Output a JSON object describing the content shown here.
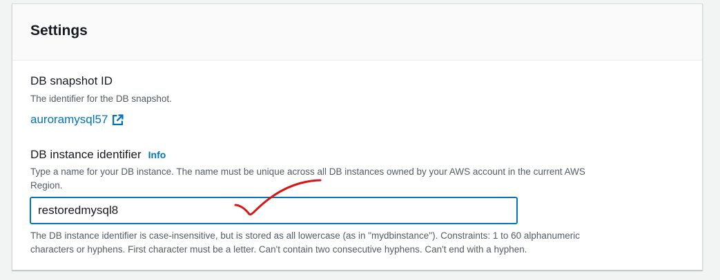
{
  "settings": {
    "title": "Settings",
    "snapshot_id": {
      "label": "DB snapshot ID",
      "description": "The identifier for the DB snapshot.",
      "value": "auroramysql57",
      "link_icon": "external-link-icon"
    },
    "instance_identifier": {
      "label": "DB instance identifier",
      "info_label": "Info",
      "description_line1": "Type a name for your DB instance. The name must be unique across all DB instances owned by your AWS account in the current AWS",
      "description_line2": "Region.",
      "value": "restoredmysql8",
      "constraint_line1": "The DB instance identifier is case-insensitive, but is stored as all lowercase (as in \"mydbinstance\"). Constraints: 1 to 60 alphanumeric",
      "constraint_line2": "characters or hyphens. First character must be a letter. Can't contain two consecutive hyphens. Can't end with a hyphen."
    }
  },
  "colors": {
    "link": "#0073bb",
    "input_border_focus": "#0073bb",
    "annotation": "#d91515"
  },
  "annotation": {
    "icon": "red-checkmark-annotation"
  }
}
